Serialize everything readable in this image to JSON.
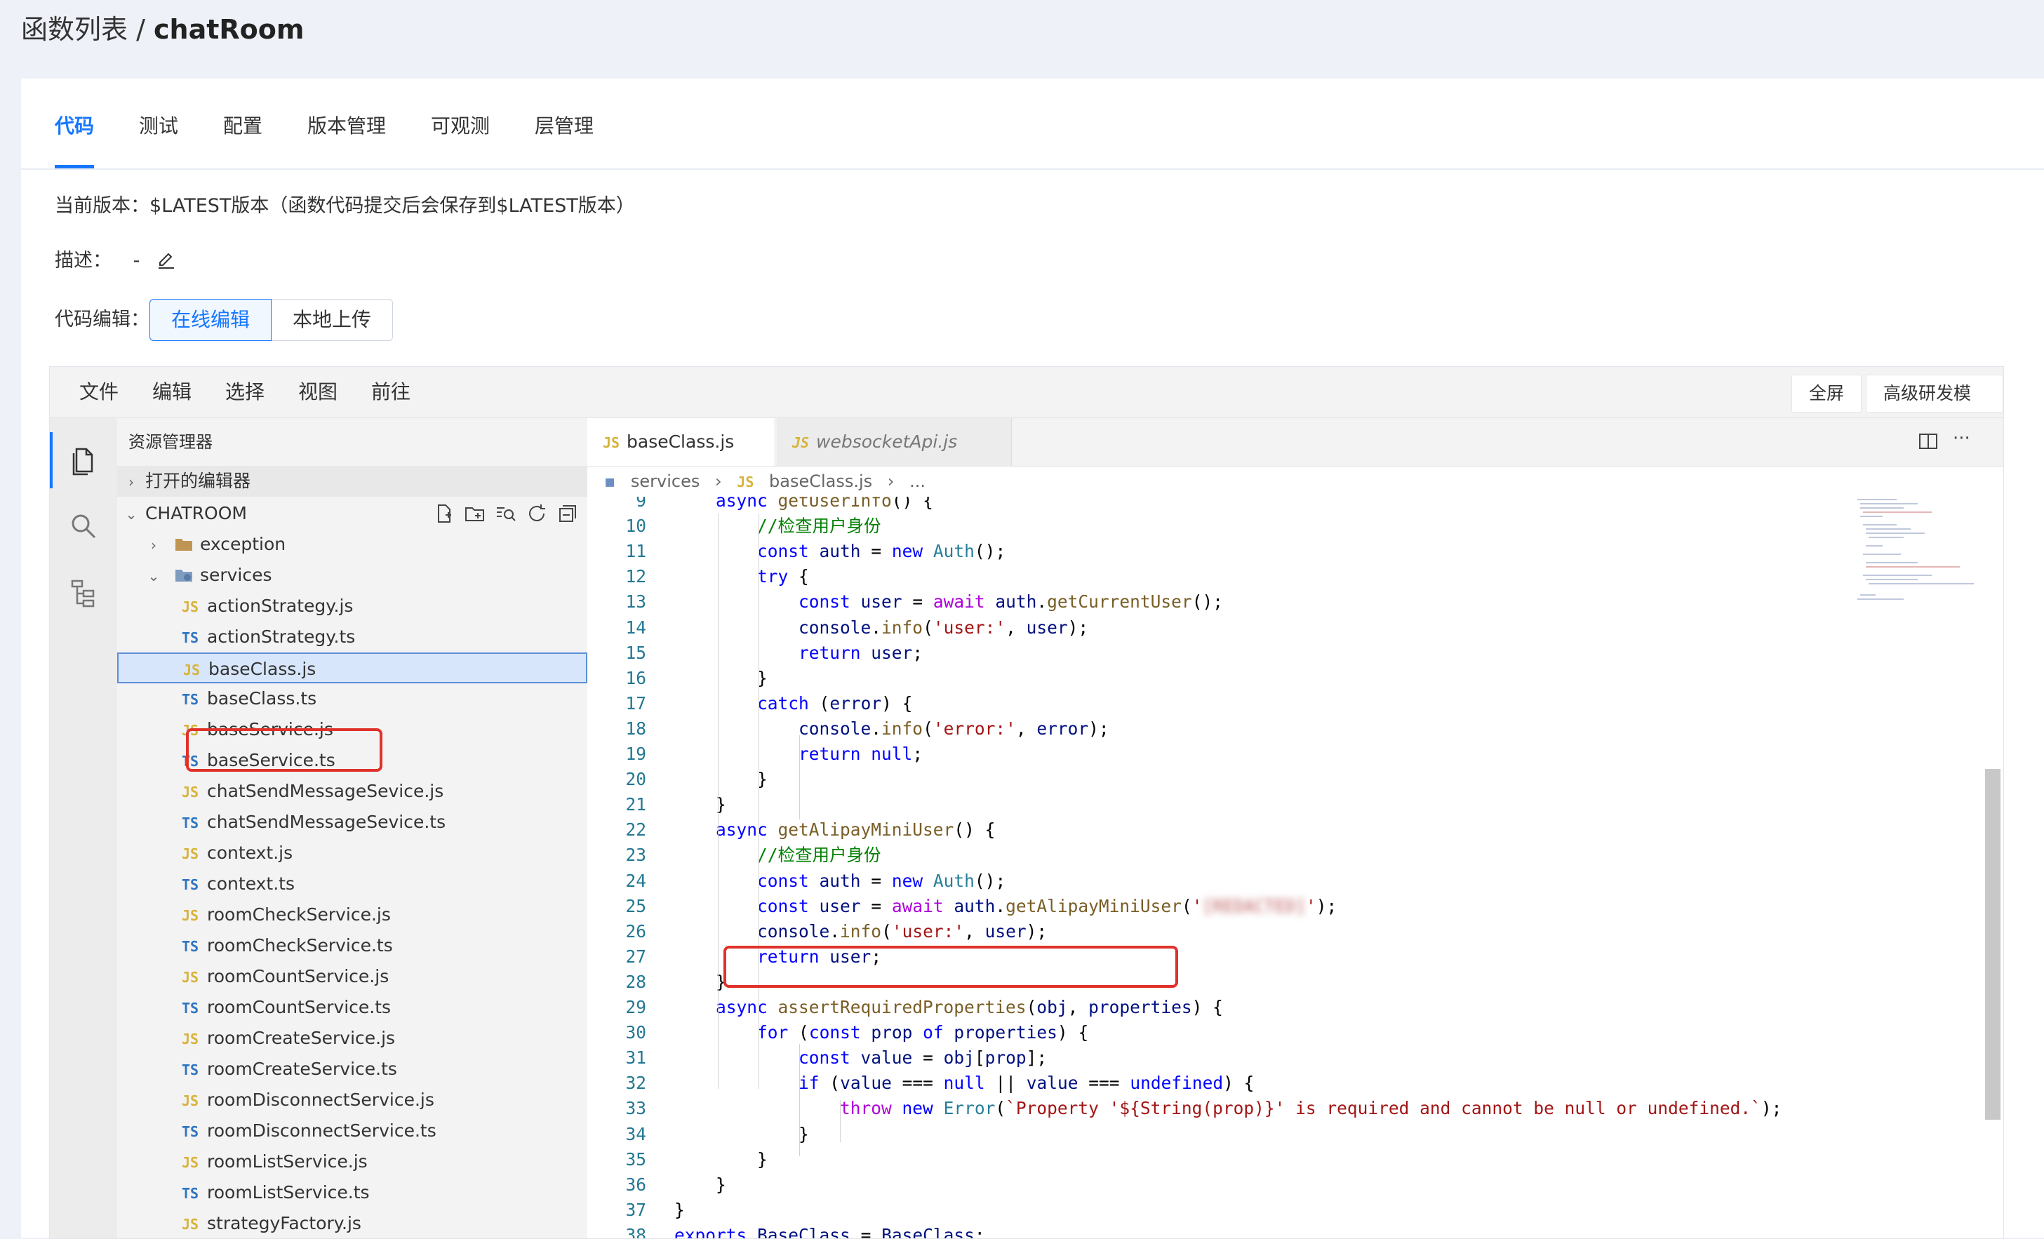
{
  "breadcrumb": {
    "root": "函数列表",
    "sep": " / ",
    "current": "chatRoom"
  },
  "tabs": [
    {
      "label": "代码",
      "active": true
    },
    {
      "label": "测试"
    },
    {
      "label": "配置"
    },
    {
      "label": "版本管理"
    },
    {
      "label": "可观测"
    },
    {
      "label": "层管理"
    }
  ],
  "meta": {
    "version_label": "当前版本：",
    "version_value": "$LATEST版本（函数代码提交后会保存到$LATEST版本）",
    "desc_label": "描述：",
    "desc_value": "-",
    "edit_mode_label": "代码编辑：",
    "edit_online": "在线编辑",
    "edit_local": "本地上传"
  },
  "ide": {
    "menu": [
      "文件",
      "编辑",
      "选择",
      "视图",
      "前往"
    ],
    "fullscreen": "全屏",
    "advanced": "高级研发模式",
    "explorer_title": "资源管理器",
    "open_editors": "打开的编辑器",
    "project": "CHATROOM",
    "folders": {
      "exception": "exception",
      "services": "services"
    },
    "files": [
      {
        "name": "actionStrategy.js",
        "type": "JS"
      },
      {
        "name": "actionStrategy.ts",
        "type": "TS"
      },
      {
        "name": "baseClass.js",
        "type": "JS",
        "selected": true
      },
      {
        "name": "baseClass.ts",
        "type": "TS"
      },
      {
        "name": "baseService.js",
        "type": "JS"
      },
      {
        "name": "baseService.ts",
        "type": "TS"
      },
      {
        "name": "chatSendMessageSevice.js",
        "type": "JS"
      },
      {
        "name": "chatSendMessageSevice.ts",
        "type": "TS"
      },
      {
        "name": "context.js",
        "type": "JS"
      },
      {
        "name": "context.ts",
        "type": "TS"
      },
      {
        "name": "roomCheckService.js",
        "type": "JS"
      },
      {
        "name": "roomCheckService.ts",
        "type": "TS"
      },
      {
        "name": "roomCountService.js",
        "type": "JS"
      },
      {
        "name": "roomCountService.ts",
        "type": "TS"
      },
      {
        "name": "roomCreateService.js",
        "type": "JS"
      },
      {
        "name": "roomCreateService.ts",
        "type": "TS"
      },
      {
        "name": "roomDisconnectService.js",
        "type": "JS"
      },
      {
        "name": "roomDisconnectService.ts",
        "type": "TS"
      },
      {
        "name": "roomListService.js",
        "type": "JS"
      },
      {
        "name": "roomListService.ts",
        "type": "TS"
      },
      {
        "name": "strategyFactory.js",
        "type": "JS"
      }
    ],
    "editor_tabs": [
      {
        "label": "baseClass.js",
        "type": "JS",
        "active": true
      },
      {
        "label": "websocketApi.js",
        "type": "JS"
      }
    ],
    "path": [
      "services",
      "baseClass.js",
      "..."
    ],
    "redacted_token": "[REDACTED]"
  },
  "code_lines": [
    {
      "n": "9",
      "t": "    async getUserInfo() {"
    },
    {
      "n": "10",
      "t": "        //检查用户身份"
    },
    {
      "n": "11",
      "t": "        const auth = new Auth();"
    },
    {
      "n": "12",
      "t": "        try {"
    },
    {
      "n": "13",
      "t": "            const user = await auth.getCurrentUser();"
    },
    {
      "n": "14",
      "t": "            console.info('user:', user);"
    },
    {
      "n": "15",
      "t": "            return user;"
    },
    {
      "n": "16",
      "t": "        }"
    },
    {
      "n": "17",
      "t": "        catch (error) {"
    },
    {
      "n": "18",
      "t": "            console.info('error:', error);"
    },
    {
      "n": "19",
      "t": "            return null;"
    },
    {
      "n": "20",
      "t": "        }"
    },
    {
      "n": "21",
      "t": "    }"
    },
    {
      "n": "22",
      "t": "    async getAlipayMiniUser() {"
    },
    {
      "n": "23",
      "t": "        //检查用户身份"
    },
    {
      "n": "24",
      "t": "        const auth = new Auth();"
    },
    {
      "n": "25",
      "t": "        const user = await auth.getAlipayMiniUser('[REDACTED]');"
    },
    {
      "n": "26",
      "t": "        console.info('user:', user);"
    },
    {
      "n": "27",
      "t": "        return user;"
    },
    {
      "n": "28",
      "t": "    }"
    },
    {
      "n": "29",
      "t": "    async assertRequiredProperties(obj, properties) {"
    },
    {
      "n": "30",
      "t": "        for (const prop of properties) {"
    },
    {
      "n": "31",
      "t": "            const value = obj[prop];"
    },
    {
      "n": "32",
      "t": "            if (value === null || value === undefined) {"
    },
    {
      "n": "33",
      "t": "                throw new Error(`Property '${String(prop)}' is required and cannot be null or undefined.`);"
    },
    {
      "n": "34",
      "t": "            }"
    },
    {
      "n": "35",
      "t": "        }"
    },
    {
      "n": "36",
      "t": "    }"
    },
    {
      "n": "37",
      "t": "}"
    },
    {
      "n": "38",
      "t": "exports.BaseClass = BaseClass;"
    }
  ],
  "colors": {
    "accent": "#1677ff",
    "highlight_box": "#e0322b"
  }
}
